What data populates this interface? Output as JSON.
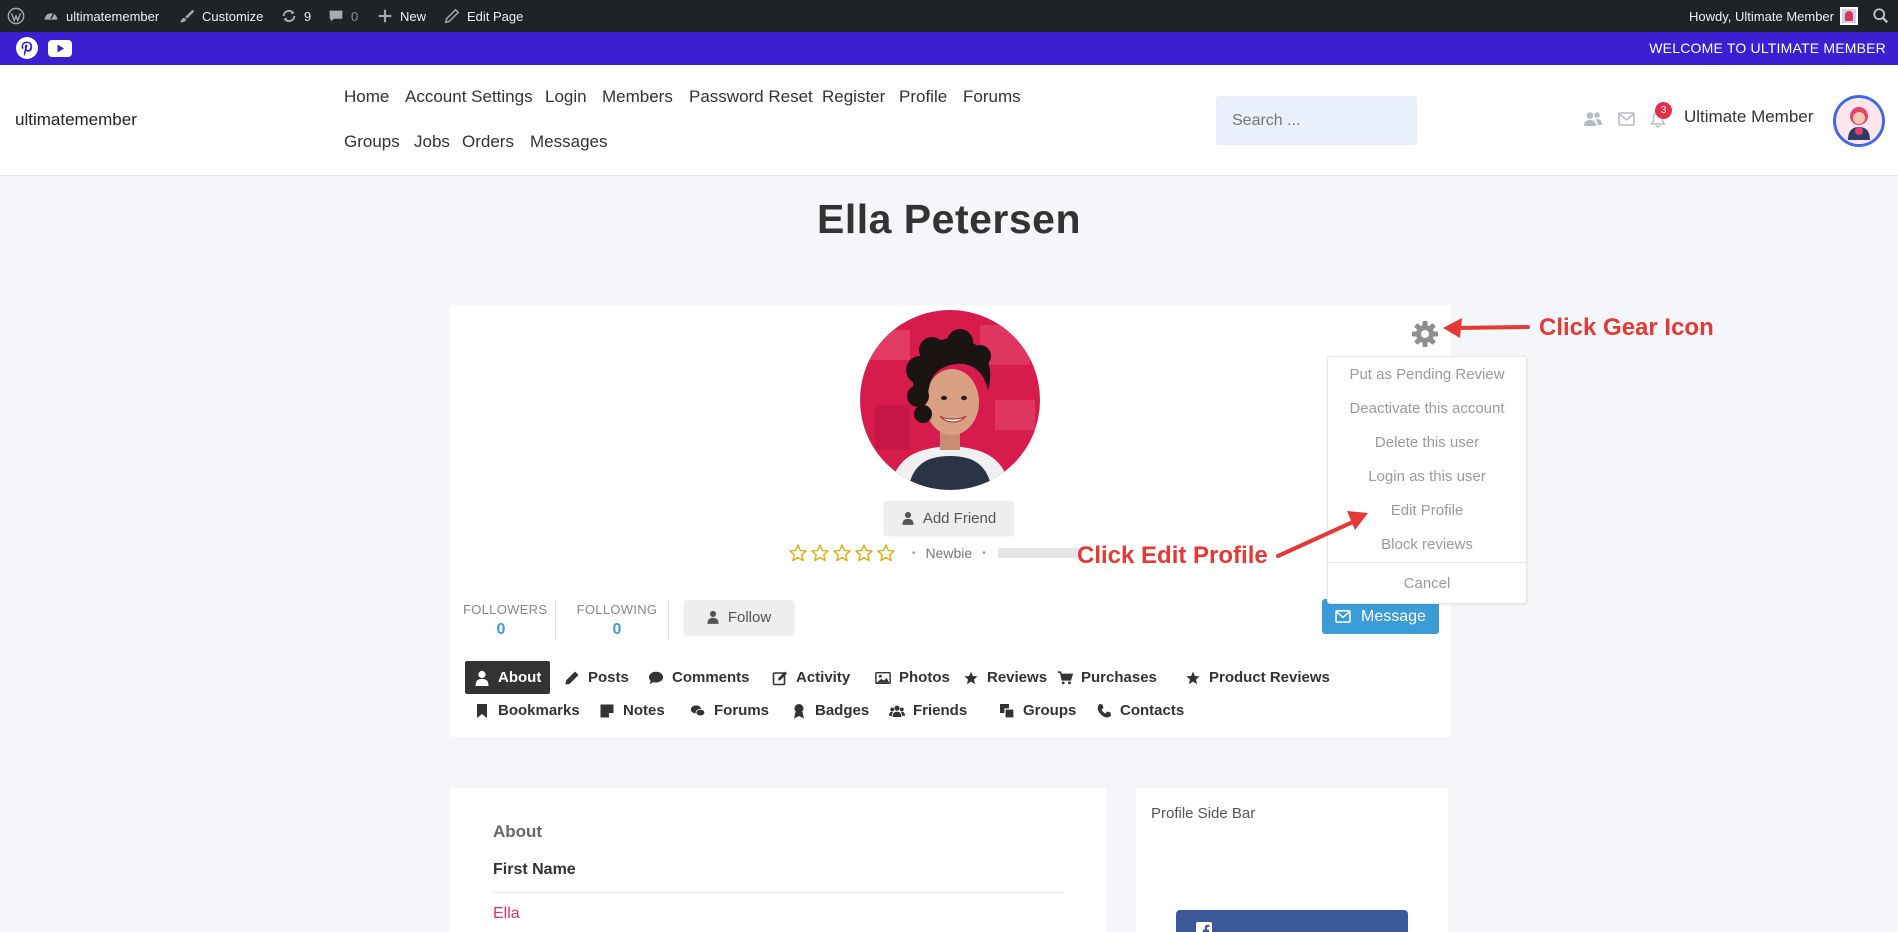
{
  "admin_bar": {
    "site_name": "ultimatemember",
    "customize": "Customize",
    "updates_count": "9",
    "comments_count": "0",
    "new_label": "New",
    "edit_page": "Edit Page",
    "howdy": "Howdy, Ultimate Member"
  },
  "top_bar": {
    "welcome": "WELCOME TO ULTIMATE MEMBER"
  },
  "header": {
    "site_title": "ultimatemember",
    "nav": [
      "Home",
      "Account Settings",
      "Login",
      "Members",
      "Password Reset",
      "Register",
      "Profile",
      "Forums",
      "Groups",
      "Jobs",
      "Orders",
      "Messages"
    ],
    "search_placeholder": "Search ...",
    "notification_count": "3",
    "user_name": "Ultimate Member"
  },
  "page": {
    "title": "Ella Petersen"
  },
  "profile": {
    "add_friend": "Add Friend",
    "rank": "Newbie",
    "rating": 0,
    "followers_label": "FOLLOWERS",
    "followers_value": "0",
    "following_label": "FOLLOWING",
    "following_value": "0",
    "follow": "Follow",
    "message": "Message",
    "tabs": [
      "About",
      "Posts",
      "Comments",
      "Activity",
      "Photos",
      "Reviews",
      "Purchases",
      "Product Reviews",
      "Bookmarks",
      "Notes",
      "Forums",
      "Badges",
      "Friends",
      "Groups",
      "Contacts"
    ],
    "active_tab": "About"
  },
  "dropdown": {
    "items": [
      "Put as Pending Review",
      "Deactivate this account",
      "Delete this user",
      "Login as this user",
      "Edit Profile",
      "Block reviews"
    ],
    "cancel": "Cancel"
  },
  "annotations": {
    "gear": "Click Gear Icon",
    "edit": "Click Edit Profile",
    "color": "#e53935"
  },
  "about": {
    "heading": "About",
    "field_label": "First Name",
    "field_value": "Ella"
  },
  "sidebar": {
    "title": "Profile Side Bar"
  },
  "colors": {
    "top_bar": "#3b1fd3",
    "accent": "#3b9dd7",
    "admin_bar": "#1d2327"
  }
}
